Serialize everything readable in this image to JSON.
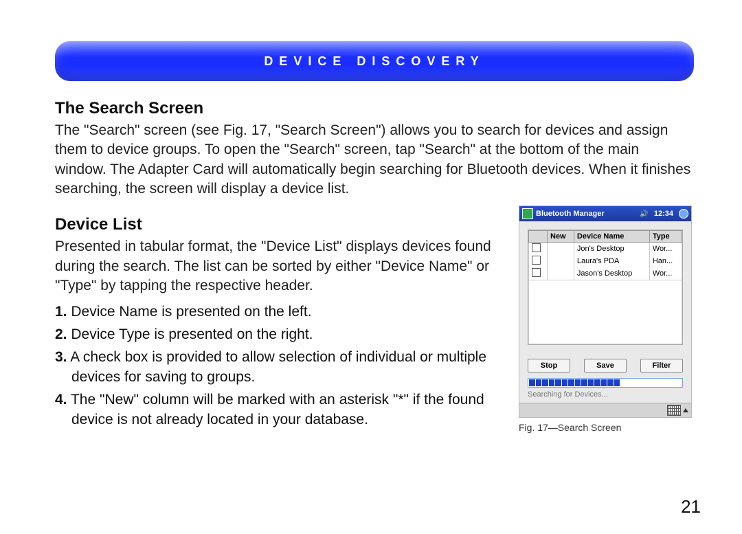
{
  "banner": {
    "title": "DEVICE DISCOVERY"
  },
  "section1": {
    "heading": "The Search Screen",
    "paragraph": "The \"Search\" screen (see Fig. 17, \"Search Screen\") allows you to search for devices and assign them to device groups. To open the \"Search\" screen, tap \"Search\" at the bottom of the main window. The Adapter Card will automatically begin searching for Bluetooth devices. When it finishes searching, the screen will display a device list."
  },
  "section2": {
    "heading": "Device List",
    "paragraph": "Presented in tabular format, the \"Device List\" displays devices found during the search. The list can be sorted by either \"Device Name\" or \"Type\" by tapping the respective header.",
    "items": [
      {
        "num": "1.",
        "text": " Device Name is presented on the left."
      },
      {
        "num": "2.",
        "text": " Device Type is presented on the right."
      },
      {
        "num": "3.",
        "text": " A check box is provided to allow selection of individual or multiple devices for saving to groups."
      },
      {
        "num": "4.",
        "text": " The \"New\" column will be marked with an asterisk \"*\" if the found device is not already located in your database."
      }
    ]
  },
  "figure": {
    "title": "Bluetooth Manager",
    "time": "12:34",
    "columns": {
      "chk": "",
      "new": "New",
      "name": "Device Name",
      "type": "Type"
    },
    "rows": [
      {
        "new": "",
        "name": "Jon's Desktop",
        "type": "Wor..."
      },
      {
        "new": "",
        "name": "Laura's PDA",
        "type": "Han..."
      },
      {
        "new": "",
        "name": "Jason's Desktop",
        "type": "Wor..."
      }
    ],
    "buttons": {
      "stop": "Stop",
      "save": "Save",
      "filter": "Filter"
    },
    "progress_segments": 14,
    "status": "Searching for Devices...",
    "caption": "Fig. 17—Search Screen"
  },
  "page_number": "21"
}
